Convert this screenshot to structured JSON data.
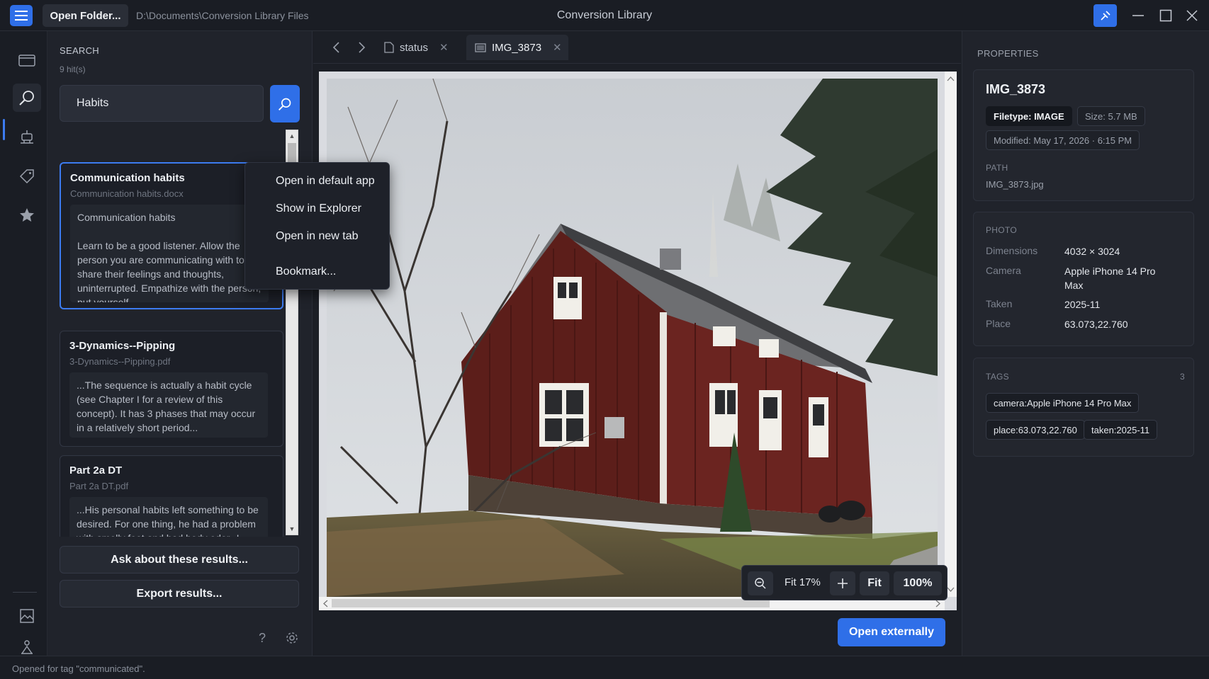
{
  "titlebar": {
    "open_folder_label": "Open Folder...",
    "path": "D:\\Documents\\Conversion Library Files",
    "app_title": "Conversion Library"
  },
  "search": {
    "heading": "SEARCH",
    "hits": "9 hit(s)",
    "query": "Habits",
    "results": [
      {
        "title": "Communication habits",
        "file": "Communication habits.docx",
        "snippet": "Communication  habits\n\nLearn to be a good listener.  Allow the person you are communicating with to share their feelings and thoughts, uninterrupted.  Empathize with the person, put yourself..."
      },
      {
        "title": "3-Dynamics--Pipping",
        "file": "3-Dynamics--Pipping.pdf",
        "snippet": "...The sequence is actually a habit cycle (see Chapter I for a review of this concept). It has 3 phases that may occur in a relatively short period..."
      },
      {
        "title": "Part 2a DT",
        "file": "Part 2a DT.pdf",
        "snippet": "...His personal habits left something to be desired.  For one thing, he had a problem with smelly feet and bad body odor--I might say that he was..."
      }
    ],
    "ask_label": "Ask about these results...",
    "export_label": "Export results..."
  },
  "context_menu": {
    "items": [
      "Open in default app",
      "Show in Explorer",
      "Open in new tab",
      "Bookmark..."
    ]
  },
  "viewer": {
    "tabs": [
      {
        "label": "status"
      },
      {
        "label": "IMG_3873"
      }
    ],
    "zoom_label": "Fit 17%",
    "fit_label": "Fit",
    "hundred_label": "100%",
    "open_externally_label": "Open externally"
  },
  "properties": {
    "heading": "PROPERTIES",
    "name": "IMG_3873",
    "filetype": "Filetype: IMAGE",
    "size": "Size: 5.7 MB",
    "modified": "Modified: May 17, 2026 · 6:15 PM",
    "path_label": "PATH",
    "path_value": "IMG_3873.jpg",
    "photo_heading": "PHOTO",
    "photo_rows": [
      {
        "label": "Dimensions",
        "value": "4032 × 3024"
      },
      {
        "label": "Camera",
        "value": "Apple iPhone 14 Pro Max"
      },
      {
        "label": "Taken",
        "value": "2025-11"
      },
      {
        "label": "Place",
        "value": "63.073,22.760"
      }
    ],
    "tags_heading": "TAGS",
    "tags_count": "3",
    "tags": [
      "camera:Apple iPhone 14 Pro Max",
      "place:63.073,22.760",
      "taken:2025-11"
    ]
  },
  "status_bar": {
    "text": "Opened for tag \"communicated\"."
  },
  "colors": {
    "accent": "#2f6fe8",
    "background": "#1c1f26",
    "panel": "#20232b"
  },
  "icons": {
    "menu": "hamburger-icon",
    "search": "search-icon",
    "remote": "remote-icon"
  }
}
